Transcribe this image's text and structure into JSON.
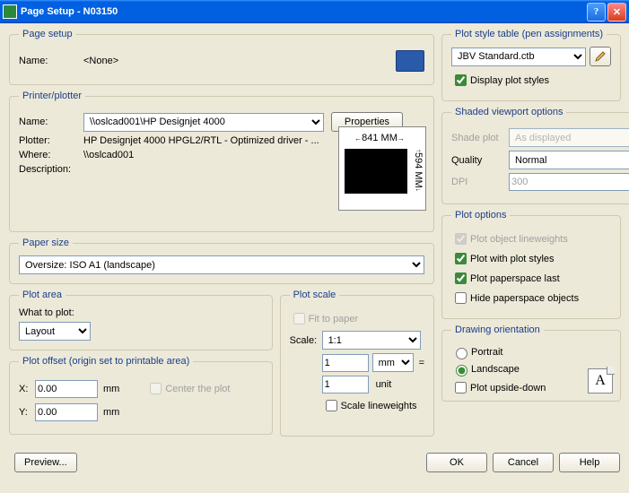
{
  "titlebar": {
    "title": "Page Setup - N03150"
  },
  "pageSetup": {
    "legend": "Page setup",
    "nameLabel": "Name:",
    "nameValue": "<None>"
  },
  "printer": {
    "legend": "Printer/plotter",
    "nameLabel": "Name:",
    "nameValue": "\\\\oslcad001\\HP Designjet 4000",
    "properties": "Properties",
    "plotterLabel": "Plotter:",
    "plotterValue": "HP Designjet 4000 HPGL2/RTL - Optimized driver - ...",
    "whereLabel": "Where:",
    "whereValue": "\\\\oslcad001",
    "descLabel": "Description:",
    "descValue": "",
    "previewW": "841 MM",
    "previewH": "594 MM"
  },
  "paper": {
    "legend": "Paper size",
    "value": "Oversize: ISO A1 (landscape)"
  },
  "plotArea": {
    "legend": "Plot area",
    "whatLabel": "What to plot:",
    "value": "Layout"
  },
  "plotScale": {
    "legend": "Plot scale",
    "fitLabel": "Fit to paper",
    "scaleLabel": "Scale:",
    "scaleValue": "1:1",
    "num": "1",
    "unit": "mm",
    "eq": "=",
    "den": "1",
    "unitLabel": "unit",
    "slw": "Scale lineweights"
  },
  "plotOffset": {
    "legend": "Plot offset (origin set to printable area)",
    "xLabel": "X:",
    "xVal": "0.00",
    "yLabel": "Y:",
    "yVal": "0.00",
    "mm": "mm",
    "center": "Center the plot"
  },
  "plotStyle": {
    "legend": "Plot style table (pen assignments)",
    "value": "JBV Standard.ctb",
    "display": "Display plot styles"
  },
  "shaded": {
    "legend": "Shaded viewport options",
    "shadeLabel": "Shade plot",
    "shadeValue": "As displayed",
    "qualityLabel": "Quality",
    "qualityValue": "Normal",
    "dpiLabel": "DPI",
    "dpiValue": "300"
  },
  "plotOptions": {
    "legend": "Plot options",
    "o1": "Plot object lineweights",
    "o2": "Plot with plot styles",
    "o3": "Plot paperspace last",
    "o4": "Hide paperspace objects"
  },
  "orientation": {
    "legend": "Drawing orientation",
    "portrait": "Portrait",
    "landscape": "Landscape",
    "upside": "Plot upside-down",
    "A": "A"
  },
  "footer": {
    "preview": "Preview...",
    "ok": "OK",
    "cancel": "Cancel",
    "help": "Help"
  }
}
